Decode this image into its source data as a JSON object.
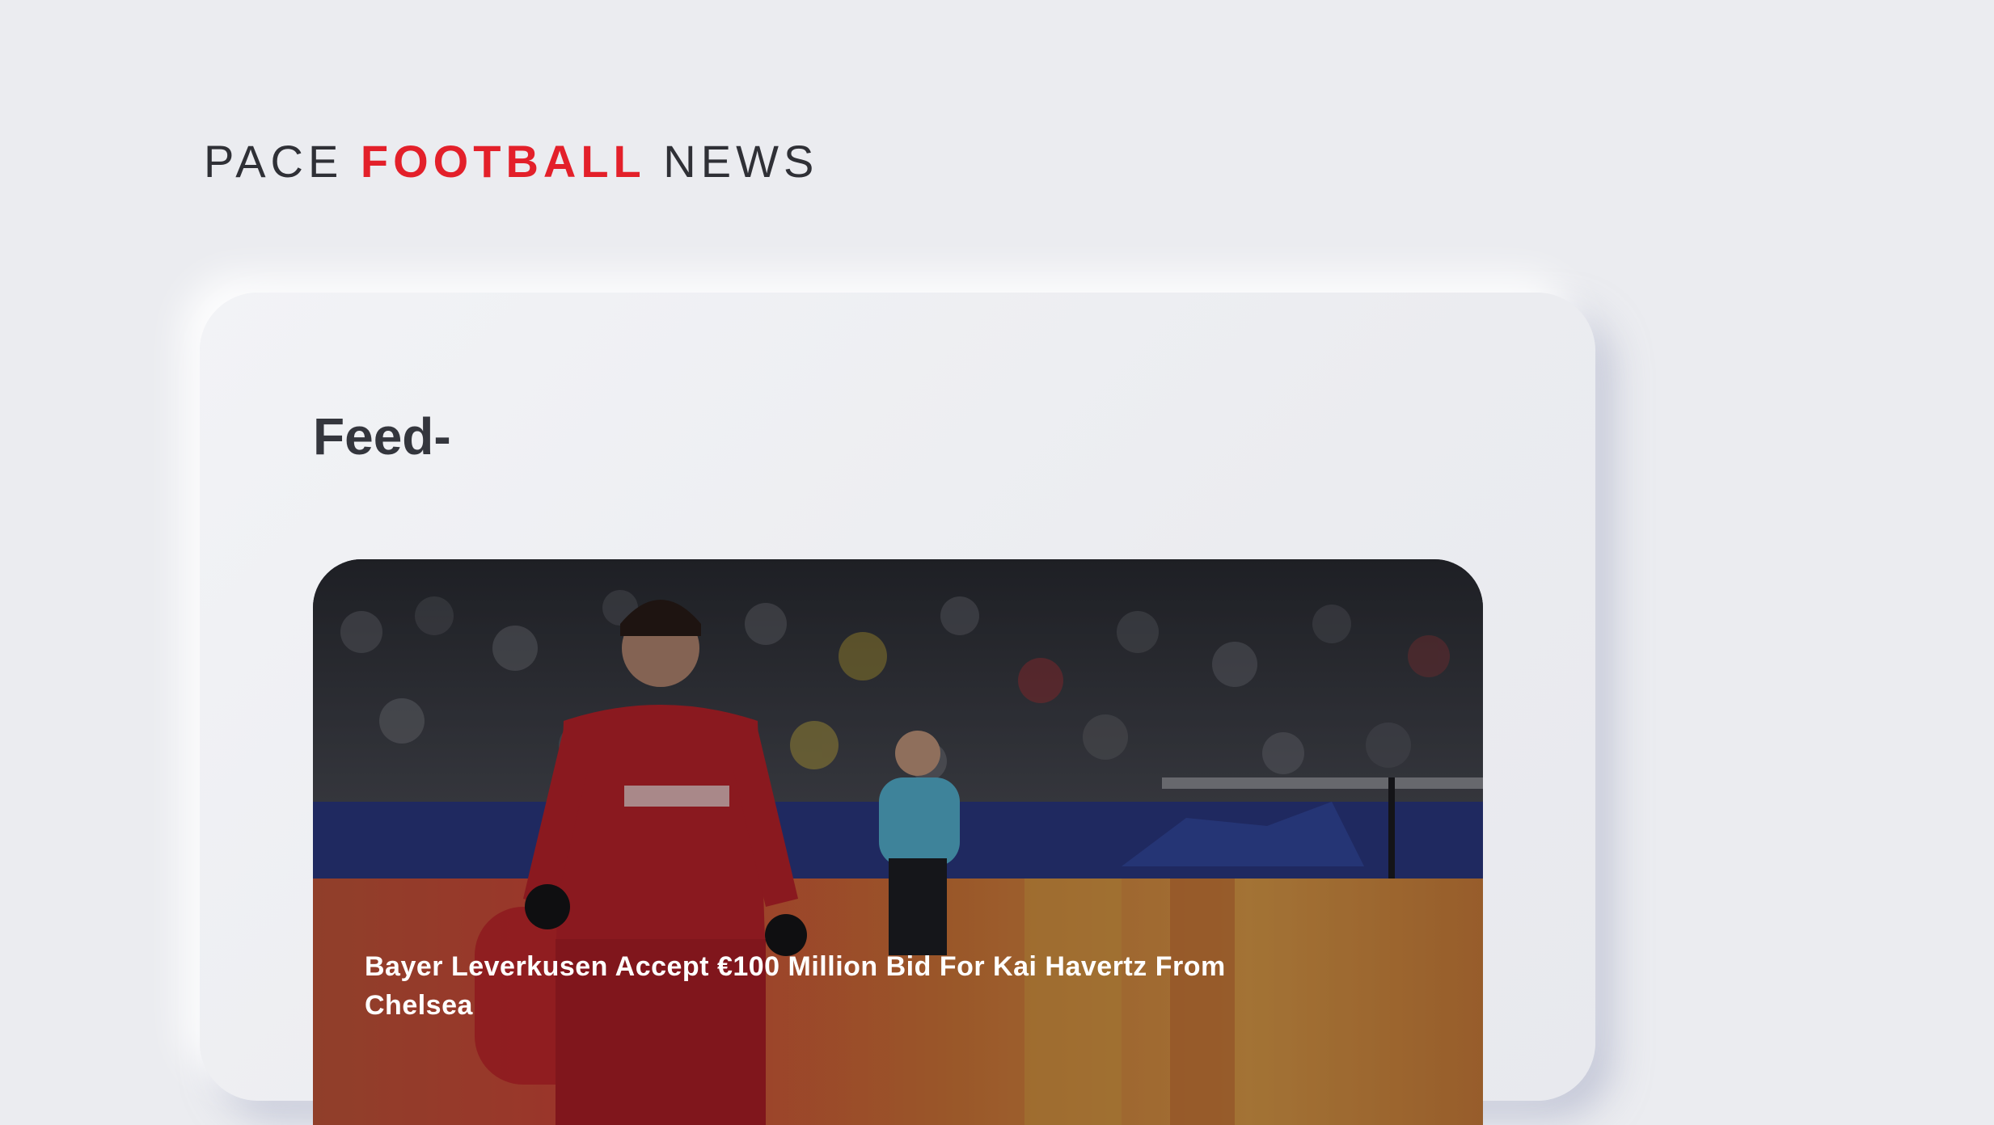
{
  "header": {
    "logo_part1": "PACE ",
    "logo_part2": "FOOTBALL",
    "logo_part3": " NEWS"
  },
  "colors": {
    "background": "#ebecf0",
    "accent": "#e3202a",
    "text": "#34363d"
  },
  "feed": {
    "title": "Feed-",
    "articles": [
      {
        "headline": "Bayer Leverkusen Accept €100 Million Bid For Kai Havertz From Chelsea",
        "image_icon": "football-player-photo"
      }
    ]
  }
}
